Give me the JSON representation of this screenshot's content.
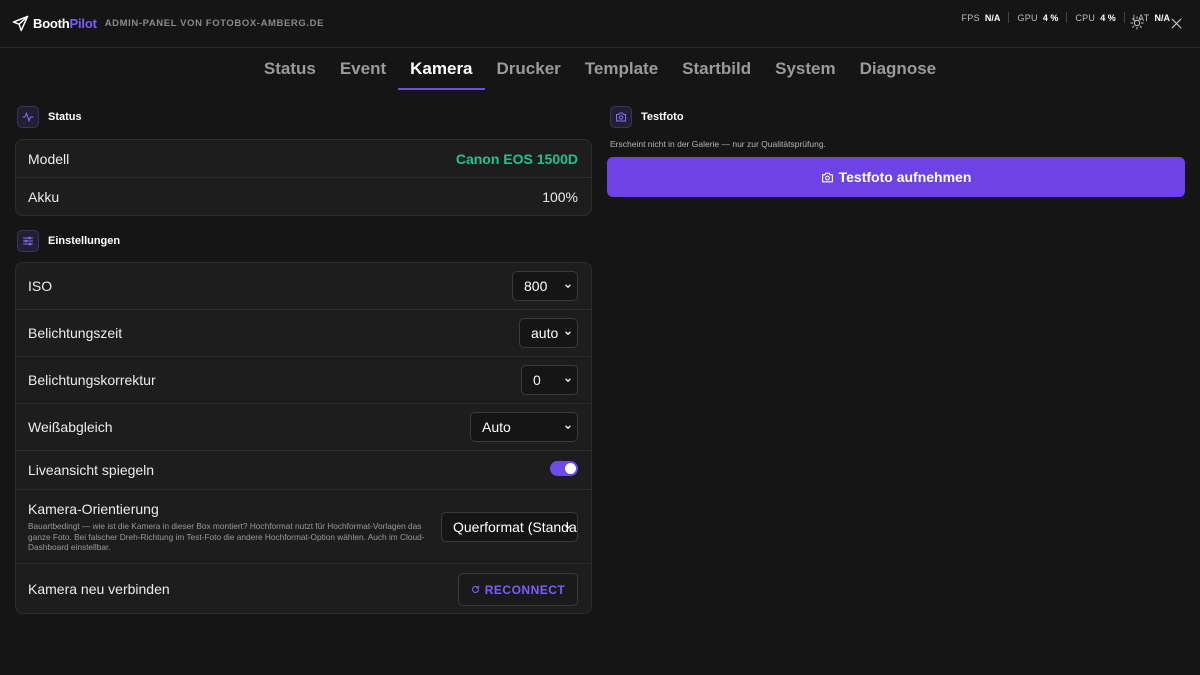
{
  "header": {
    "brand_main": "Booth",
    "brand_accent": "Pilot",
    "subtitle": "ADMIN-PANEL VON FOTOBOX-AMBERG.DE",
    "stats": [
      {
        "label": "FPS",
        "value": "N/A"
      },
      {
        "label": "GPU",
        "value": "4 %"
      },
      {
        "label": "CPU",
        "value": "4 %"
      },
      {
        "label": "LAT",
        "value": "N/A"
      }
    ],
    "icons": {
      "theme": "sun-icon",
      "close": "close-icon"
    }
  },
  "tabs": [
    {
      "label": "Status",
      "active": false
    },
    {
      "label": "Event",
      "active": false
    },
    {
      "label": "Kamera",
      "active": true
    },
    {
      "label": "Drucker",
      "active": false
    },
    {
      "label": "Template",
      "active": false
    },
    {
      "label": "Startbild",
      "active": false
    },
    {
      "label": "System",
      "active": false
    },
    {
      "label": "Diagnose",
      "active": false
    }
  ],
  "status_section": {
    "title": "Status",
    "rows": [
      {
        "label": "Modell",
        "value": "Canon EOS 1500D"
      },
      {
        "label": "Akku",
        "value": "100%"
      }
    ]
  },
  "settings_section": {
    "title": "Einstellungen",
    "iso": {
      "label": "ISO",
      "value": "800"
    },
    "shutter": {
      "label": "Belichtungszeit",
      "value": "auto"
    },
    "exposure": {
      "label": "Belichtungskorrektur",
      "value": "0"
    },
    "whitebalance": {
      "label": "Weißabgleich",
      "value": "Auto"
    },
    "mirror": {
      "label": "Liveansicht spiegeln",
      "enabled": true
    },
    "orientation": {
      "label": "Kamera-Orientierung",
      "description": "Bauartbedingt — wie ist die Kamera in dieser Box montiert? Hochformat nutzt für Hochformat-Vorlagen das ganze Foto. Bei falscher Dreh-Richtung im Test-Foto die andere Hochformat-Option wählen. Auch im Cloud-Dashboard einstellbar.",
      "value": "Querformat (Standard)"
    },
    "reconnect": {
      "label": "Kamera neu verbinden",
      "button": "RECONNECT"
    }
  },
  "testfoto": {
    "title": "Testfoto",
    "hint": "Erscheint nicht in der Galerie — nur zur Qualitätsprüfung.",
    "button": "Testfoto aufnehmen"
  },
  "colors": {
    "accent": "#6d4be8",
    "success": "#22c38e",
    "background": "#151515",
    "card": "#1d1d1d"
  }
}
